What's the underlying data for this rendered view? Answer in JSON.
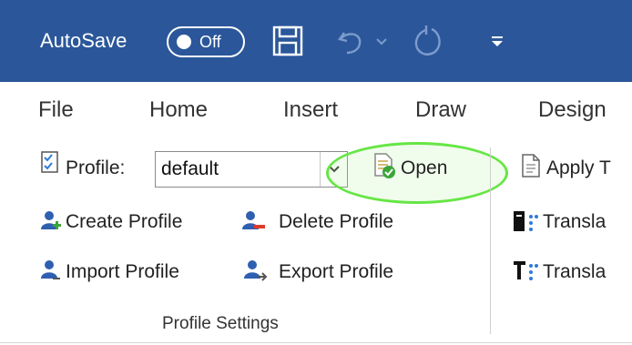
{
  "title_bar": {
    "autosave_label": "AutoSave",
    "autosave_state": "Off",
    "icons": [
      "save-icon",
      "undo-icon",
      "undo-dropdown-icon",
      "redo-icon",
      "customize-qat-icon"
    ]
  },
  "tabs": [
    {
      "label": "File"
    },
    {
      "label": "Home"
    },
    {
      "label": "Insert"
    },
    {
      "label": "Draw"
    },
    {
      "label": "Design"
    }
  ],
  "ribbon": {
    "profile_label": "Profile:",
    "profile_value": "default",
    "open_label": "Open",
    "create_profile_label": "Create Profile",
    "delete_profile_label": "Delete Profile",
    "import_profile_label": "Import Profile",
    "export_profile_label": "Export  Profile",
    "group_label": "Profile Settings",
    "apply_label": "Apply T",
    "translate_1_label": "Transla",
    "translate_2_label": "Transla"
  },
  "colors": {
    "title_bar": "#2b579a",
    "highlight": "#66e645",
    "tab_text": "#333333"
  }
}
